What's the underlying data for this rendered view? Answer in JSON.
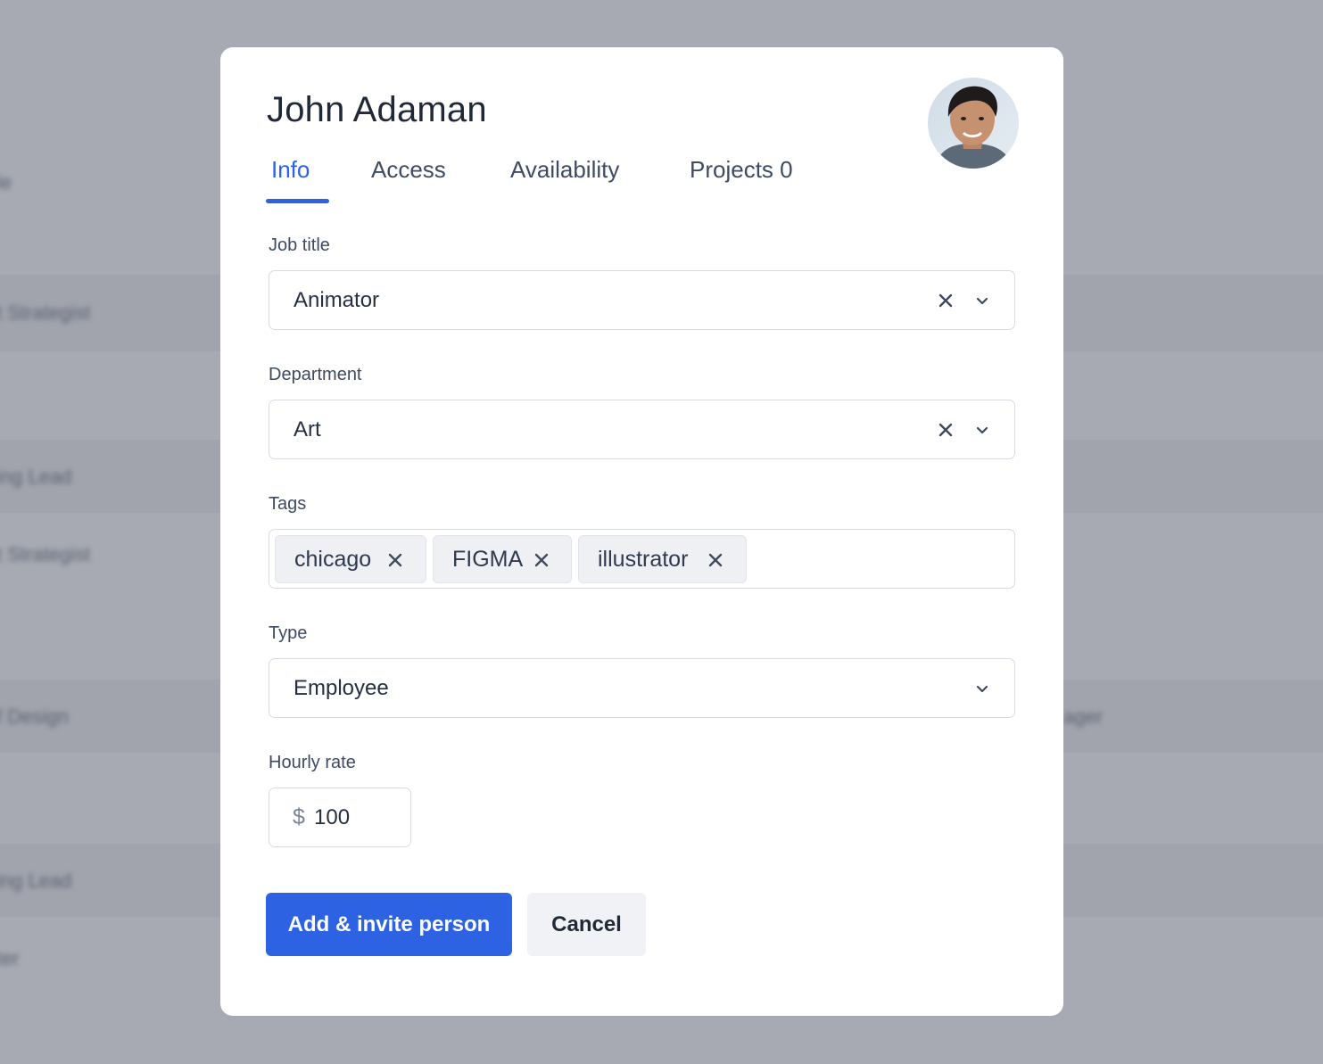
{
  "background": {
    "rows": [
      "le",
      "t Strategist",
      "ing Lead",
      "t Strategist",
      "f Design",
      "ager",
      "ing Lead",
      "ter"
    ]
  },
  "modal": {
    "title": "John Adaman",
    "tabs": [
      {
        "label": "Info",
        "active": true
      },
      {
        "label": "Access",
        "active": false
      },
      {
        "label": "Availability",
        "active": false
      },
      {
        "label": "Projects",
        "count": "0",
        "active": false
      }
    ],
    "job_title": {
      "label": "Job title",
      "value": "Animator"
    },
    "department": {
      "label": "Department",
      "value": "Art"
    },
    "tags": {
      "label": "Tags",
      "items": [
        "chicago",
        "FIGMA",
        "illustrator"
      ]
    },
    "type": {
      "label": "Type",
      "value": "Employee"
    },
    "hourly_rate": {
      "label": "Hourly rate",
      "currency": "$",
      "value": "100"
    },
    "buttons": {
      "primary": "Add & invite person",
      "secondary": "Cancel"
    }
  },
  "colors": {
    "accent": "#2d63e3",
    "overlay": "#a9acb4",
    "text": "#1f2937"
  }
}
